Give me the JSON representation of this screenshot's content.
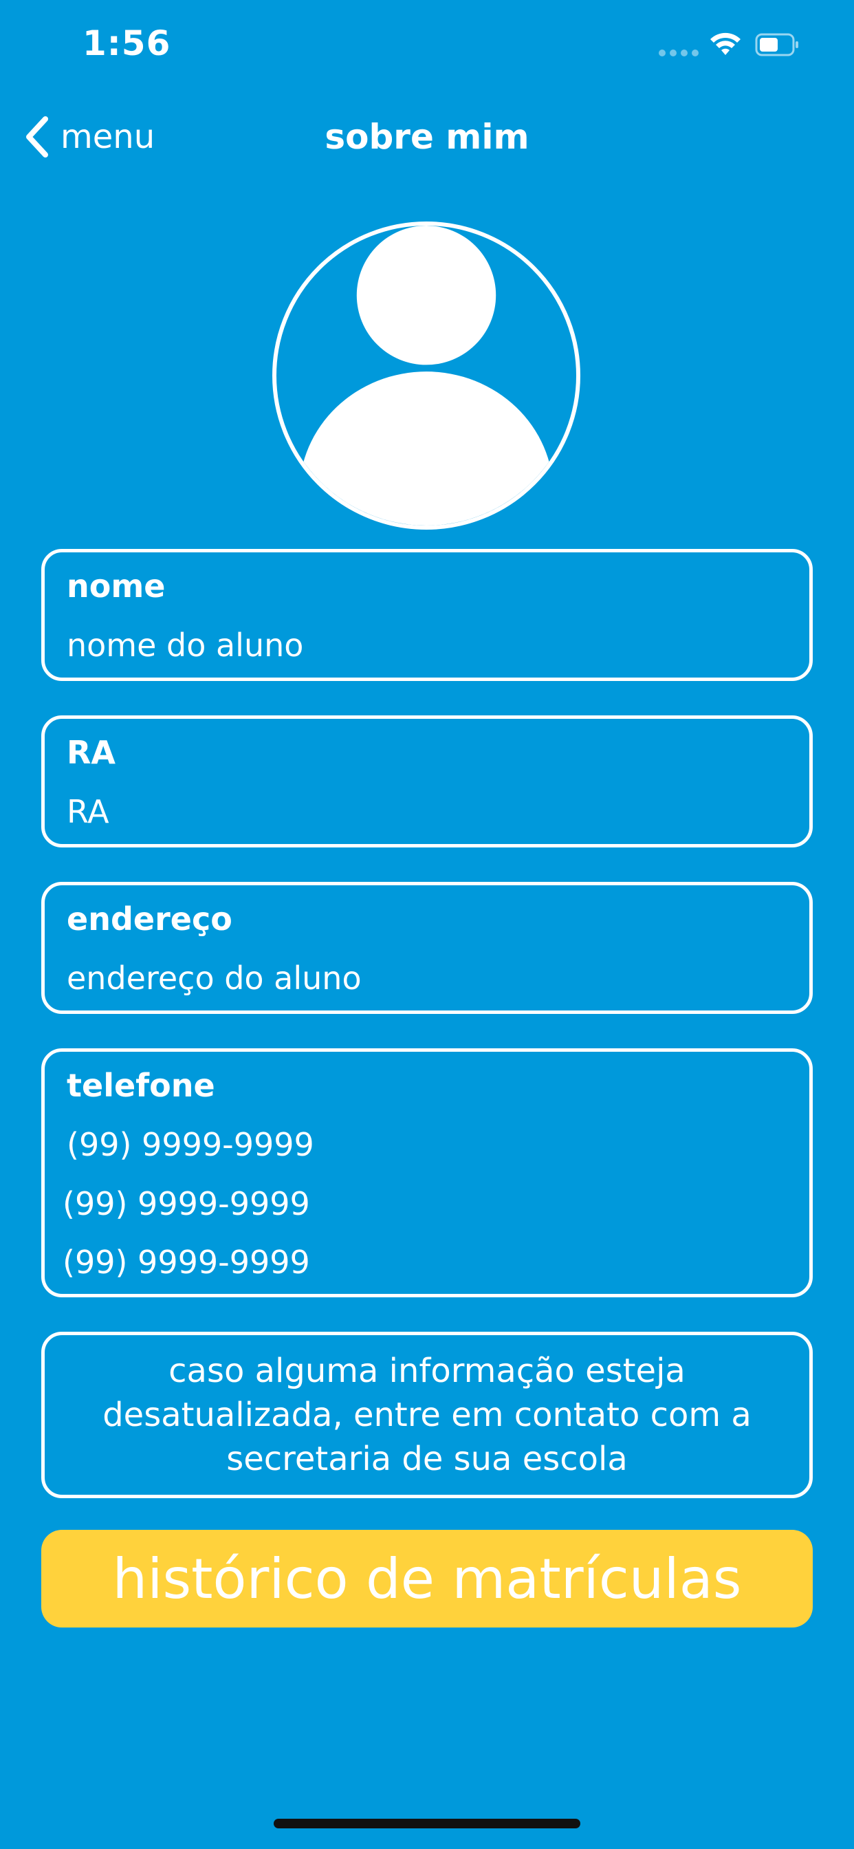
{
  "status_bar": {
    "time": "1:56",
    "icons": [
      "signal-icon",
      "wifi-icon",
      "battery-icon"
    ]
  },
  "nav": {
    "back_label": "menu",
    "back_icon": "chevron-left-icon",
    "title": "sobre mim"
  },
  "avatar": {
    "icon": "user-placeholder-icon"
  },
  "fields": {
    "nome": {
      "label": "nome",
      "value": "nome do aluno"
    },
    "ra": {
      "label": "RA",
      "value": "RA"
    },
    "endereco": {
      "label": "endereço",
      "value": "endereço do aluno"
    },
    "telefone": {
      "label": "telefone",
      "values": [
        "(99) 9999-9999",
        "(99) 9999-9999",
        "(99) 9999-9999"
      ]
    }
  },
  "notice": {
    "text": "caso alguma informação esteja desatualizada, entre em contato com a secretaria de sua escola"
  },
  "history_button": {
    "label": "histórico de matrículas"
  },
  "colors": {
    "background": "#0099DB",
    "button": "#FFD23C",
    "text": "#FFFFFF"
  }
}
